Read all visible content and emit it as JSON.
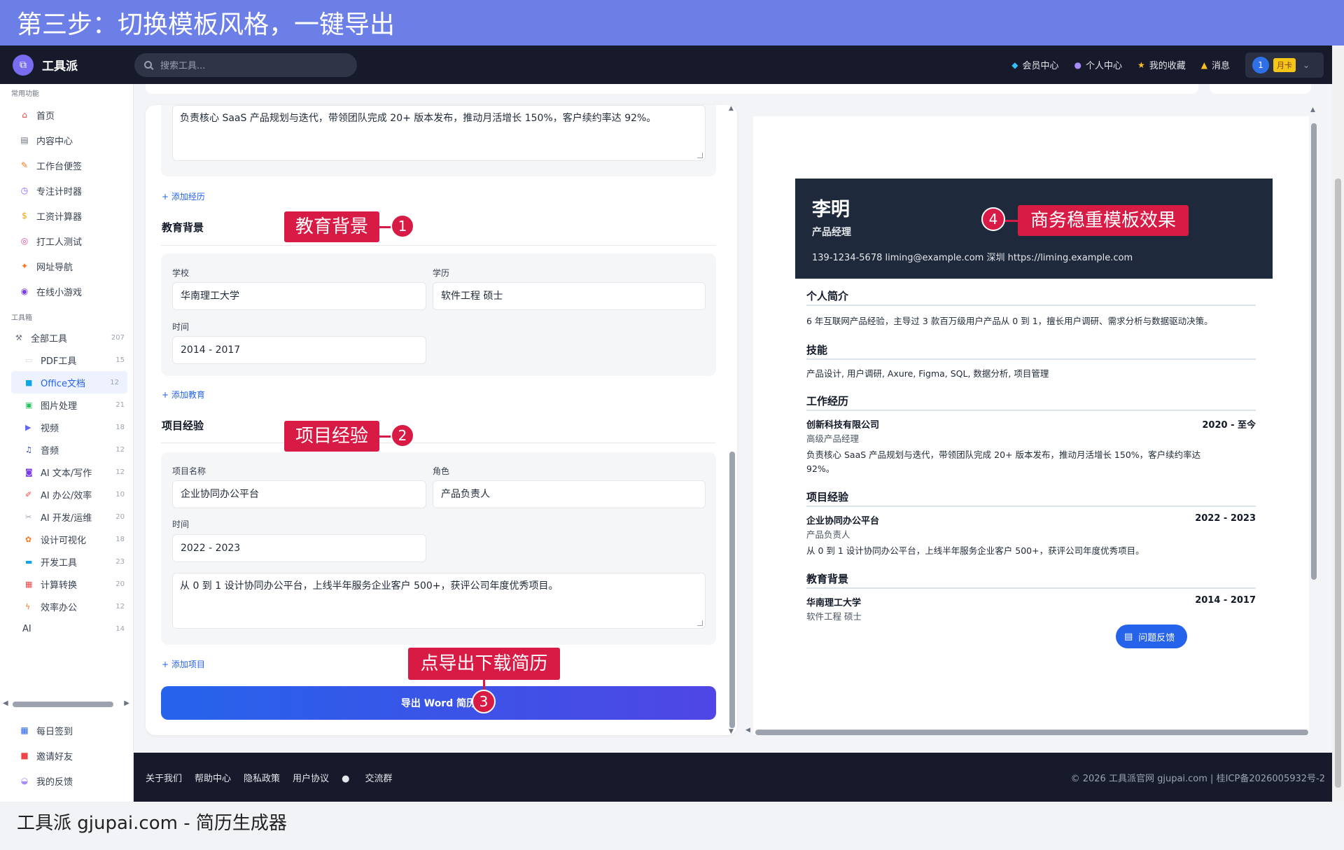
{
  "banner_top": "第三步：切换模板风格，一键导出",
  "banner_bottom": "工具派 gjupai.com - 简历生成器",
  "navbar": {
    "logo_text": "工具派",
    "search_placeholder": "搜索工具...",
    "links": [
      {
        "icon": "diamond-icon",
        "label": "会员中心"
      },
      {
        "icon": "user-icon",
        "label": "个人中心"
      },
      {
        "icon": "star-icon",
        "label": "我的收藏"
      },
      {
        "icon": "bell-icon",
        "label": "消息"
      }
    ],
    "user_number": "1",
    "vip_badge": "月卡"
  },
  "sidebar": {
    "common_title": "常用功能",
    "common_items": [
      "首页",
      "内容中心",
      "工作台便签",
      "专注计时器",
      "工资计算器",
      "打工人测试",
      "网址导航",
      "在线小游戏"
    ],
    "tools_title": "工具箱",
    "all_tools": {
      "label": "全部工具",
      "count": "207"
    },
    "tools": [
      {
        "label": "PDF工具",
        "count": "15"
      },
      {
        "label": "Office文档",
        "count": "12",
        "active": true
      },
      {
        "label": "图片处理",
        "count": "21"
      },
      {
        "label": "视频",
        "count": "18"
      },
      {
        "label": "音频",
        "count": "12"
      },
      {
        "label": "AI 文本/写作",
        "count": "12"
      },
      {
        "label": "AI 办公/效率",
        "count": "10"
      },
      {
        "label": "AI 开发/运维",
        "count": "20"
      },
      {
        "label": "设计可视化",
        "count": "18"
      },
      {
        "label": "开发工具",
        "count": "23"
      },
      {
        "label": "计算转换",
        "count": "20"
      },
      {
        "label": "效率办公",
        "count": "12"
      }
    ],
    "ai_item": {
      "label": "AI",
      "count": "14"
    },
    "bottom_items": [
      "每日签到",
      "邀请好友",
      "我的反馈"
    ]
  },
  "editor": {
    "work_desc": "负责核心 SaaS 产品规划与迭代，带领团队完成 20+ 版本发布，推动月活增长 150%，客户续约率达 92%。",
    "add_experience": "+ 添加经历",
    "education_title": "教育背景",
    "school_label": "学校",
    "school_value": "华南理工大学",
    "degree_label": "学历",
    "degree_value": "软件工程 硕士",
    "edu_time_label": "时间",
    "edu_time_value": "2014 - 2017",
    "add_education": "+ 添加教育",
    "project_title": "项目经验",
    "project_name_label": "项目名称",
    "project_name_value": "企业协同办公平台",
    "role_label": "角色",
    "role_value": "产品负责人",
    "project_time_label": "时间",
    "project_time_value": "2022 - 2023",
    "project_desc": "从 0 到 1 设计协同办公平台，上线半年服务企业客户 500+，获评公司年度优秀项目。",
    "add_project": "+ 添加项目",
    "export_button": "导出 Word 简历"
  },
  "resume": {
    "name": "李明",
    "title": "产品经理",
    "contact": "139-1234-5678   liming@example.com   深圳   https://liming.example.com",
    "summary_title": "个人简介",
    "summary": "6 年互联网产品经验，主导过 3 款百万级用户产品从 0 到 1，擅长用户调研、需求分析与数据驱动决策。",
    "skills_title": "技能",
    "skills": "产品设计, 用户调研, Axure, Figma, SQL, 数据分析, 项目管理",
    "work_title": "工作经历",
    "work_company": "创新科技有限公司",
    "work_period": "2020 - 至今",
    "work_role": "高级产品经理",
    "work_desc_line1": "负责核心 SaaS 产品规划与迭代，带领团队完成 20+ 版本发布，推动月活增长 150%，客户续约率达",
    "work_desc_line2": "92%。",
    "project_title": "项目经验",
    "project_name": "企业协同办公平台",
    "project_period": "2022 - 2023",
    "project_role": "产品负责人",
    "project_desc": "从 0 到 1 设计协同办公平台，上线半年服务企业客户 500+，获评公司年度优秀项目。",
    "edu_title": "教育背景",
    "edu_school": "华南理工大学",
    "edu_period": "2014 - 2017",
    "edu_degree": "软件工程 硕士"
  },
  "feedback_button": "问题反馈",
  "footer": {
    "links": [
      "关于我们",
      "帮助中心",
      "隐私政策",
      "用户协议",
      "交流群"
    ],
    "copyright": "© 2026 工具派官网 gjupai.com | 桂ICP备2026005932号-2"
  },
  "annotations": {
    "edu": {
      "label": "教育背景",
      "num": "1"
    },
    "proj": {
      "label": "项目经验",
      "num": "2"
    },
    "export": {
      "label": "点导出下载简历",
      "num": "3"
    },
    "template": {
      "label": "商务稳重模板效果",
      "num": "4"
    }
  },
  "colors": {
    "accent": "#2563eb",
    "annotation": "#d81b45",
    "resume_header": "#1e293b",
    "navbar": "#161a2b",
    "banner": "#6b7fe6"
  }
}
